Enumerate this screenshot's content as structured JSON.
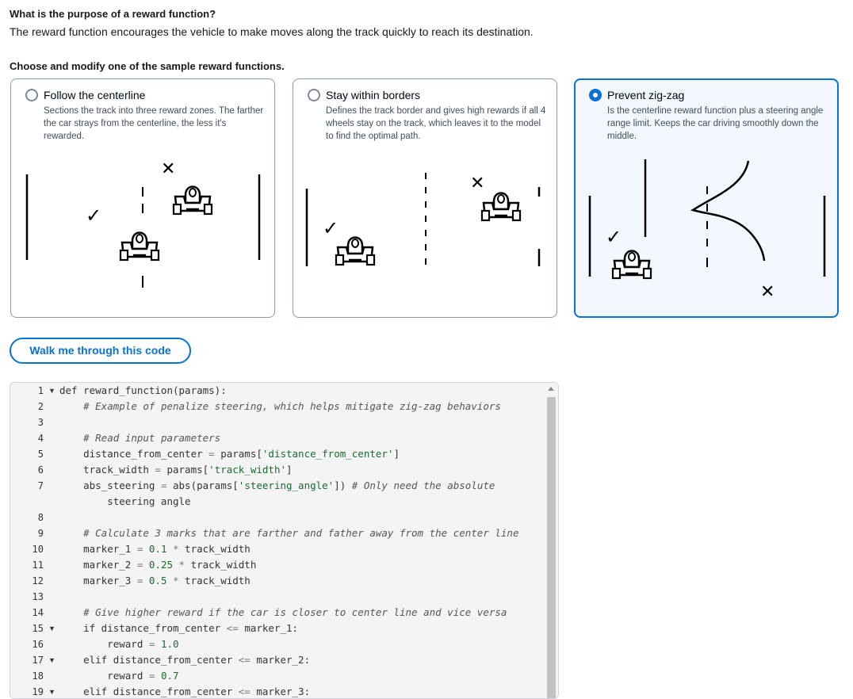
{
  "question": {
    "title": "What is the purpose of a reward function?",
    "answer": "The reward function encourages the vehicle to make moves along the track quickly to reach its destination."
  },
  "choose_heading": "Choose and modify one of the sample reward functions.",
  "cards": [
    {
      "title": "Follow the centerline",
      "desc": "Sections the track into three reward zones. The farther the car strays from the centerline, the less it's rewarded.",
      "selected": false
    },
    {
      "title": "Stay within borders",
      "desc": "Defines the track border and gives high rewards if all 4 wheels stay on the track, which leaves it to the model to find the optimal path.",
      "selected": false
    },
    {
      "title": "Prevent zig-zag",
      "desc": "Is the centerline reward function plus a steering angle range limit. Keeps the car driving smoothly down the middle.",
      "selected": true
    }
  ],
  "illustration_marks": {
    "check": "✓",
    "cross": "✕"
  },
  "walk_button": "Walk me through this code",
  "editor": {
    "lines": [
      {
        "n": "1",
        "fold": true,
        "text": "def reward_function(params):"
      },
      {
        "n": "2",
        "fold": false,
        "text": "    # Example of penalize steering, which helps mitigate zig-zag behaviors"
      },
      {
        "n": "3",
        "fold": false,
        "text": ""
      },
      {
        "n": "4",
        "fold": false,
        "text": "    # Read input parameters"
      },
      {
        "n": "5",
        "fold": false,
        "text": "    distance_from_center = params['distance_from_center']"
      },
      {
        "n": "6",
        "fold": false,
        "text": "    track_width = params['track_width']"
      },
      {
        "n": "7",
        "fold": false,
        "text": "    abs_steering = abs(params['steering_angle']) # Only need the absolute"
      },
      {
        "n": "",
        "fold": false,
        "text": "        steering angle"
      },
      {
        "n": "8",
        "fold": false,
        "text": ""
      },
      {
        "n": "9",
        "fold": false,
        "text": "    # Calculate 3 marks that are farther and father away from the center line"
      },
      {
        "n": "10",
        "fold": false,
        "text": "    marker_1 = 0.1 * track_width"
      },
      {
        "n": "11",
        "fold": false,
        "text": "    marker_2 = 0.25 * track_width"
      },
      {
        "n": "12",
        "fold": false,
        "text": "    marker_3 = 0.5 * track_width"
      },
      {
        "n": "13",
        "fold": false,
        "text": ""
      },
      {
        "n": "14",
        "fold": false,
        "text": "    # Give higher reward if the car is closer to center line and vice versa"
      },
      {
        "n": "15",
        "fold": true,
        "text": "    if distance_from_center <= marker_1:"
      },
      {
        "n": "16",
        "fold": false,
        "text": "        reward = 1.0"
      },
      {
        "n": "17",
        "fold": true,
        "text": "    elif distance_from_center <= marker_2:"
      },
      {
        "n": "18",
        "fold": false,
        "text": "        reward = 0.7"
      },
      {
        "n": "19",
        "fold": true,
        "text": "    elif distance_from_center <= marker_3:"
      }
    ]
  }
}
